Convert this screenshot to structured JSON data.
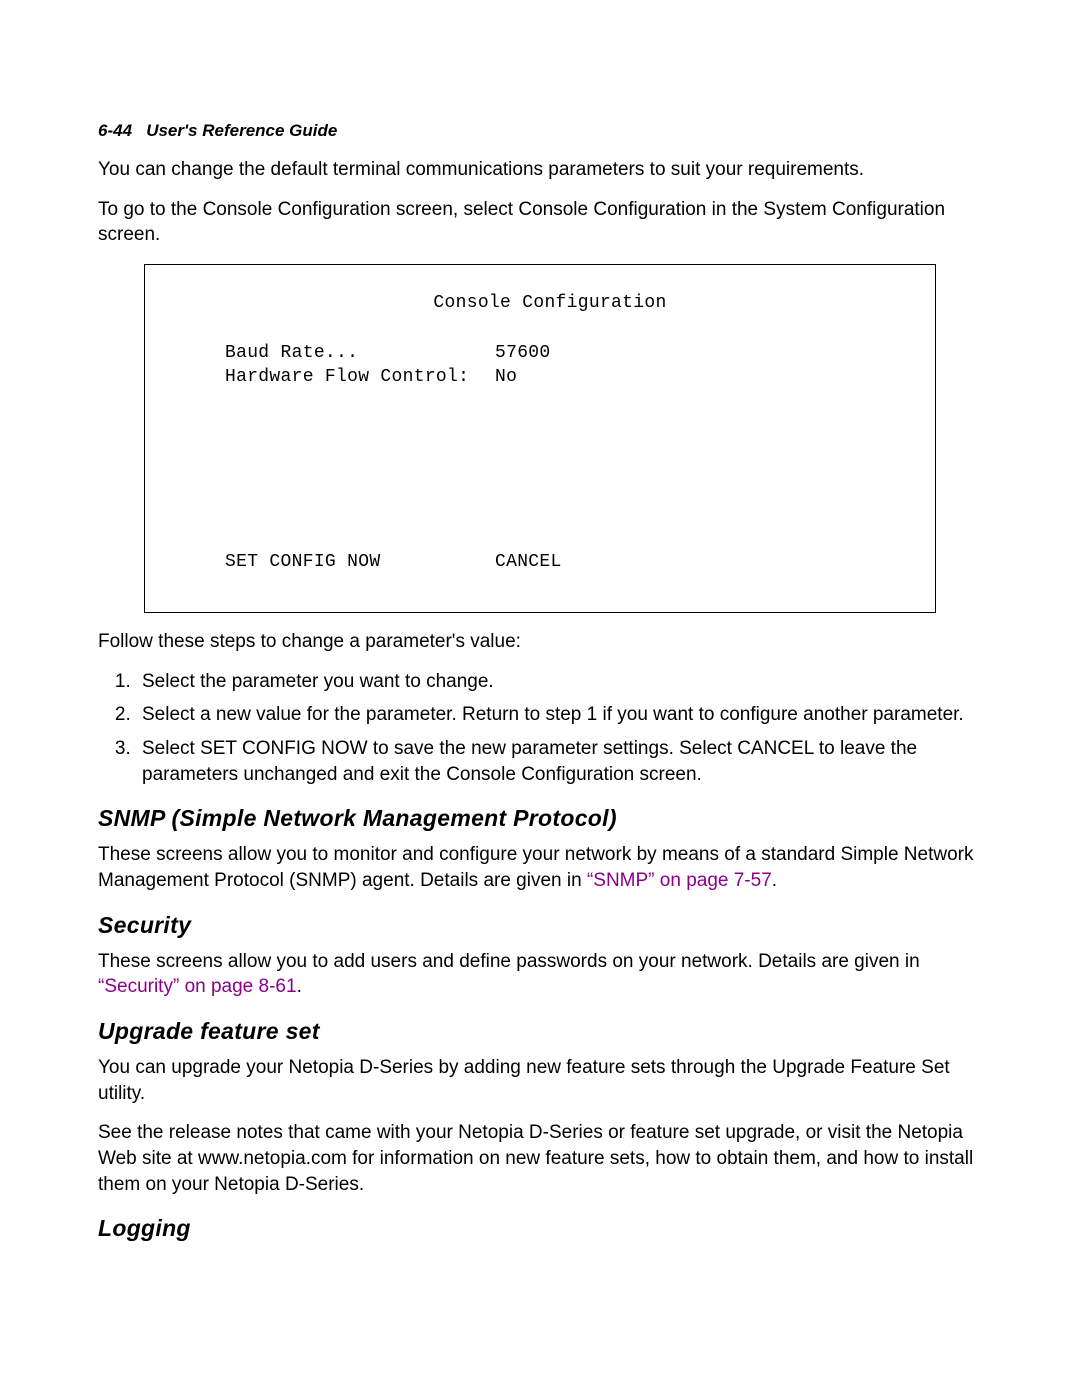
{
  "header": {
    "page_number": "6-44",
    "book_title": "User's Reference Guide"
  },
  "intro": {
    "para1": "You can change the default terminal communications parameters to suit your requirements.",
    "para2": "To go to the Console Configuration screen, select Console Configuration in the System Configuration screen."
  },
  "console": {
    "title": "Console Configuration",
    "row1_label": "Baud Rate...",
    "row1_value": "57600",
    "row2_label": "Hardware Flow Control:",
    "row2_value": "No",
    "action_set": "SET CONFIG NOW",
    "action_cancel": "CANCEL"
  },
  "steps": {
    "lead": "Follow these steps to change a parameter's value:",
    "items": [
      "Select the parameter you want to change.",
      "Select a new value for the parameter. Return to step 1 if you want to configure another parameter.",
      "Select SET CONFIG NOW to save the new parameter settings. Select CANCEL to leave the parameters unchanged and exit the Console Configuration screen."
    ]
  },
  "snmp": {
    "heading": "SNMP (Simple Network Management Protocol)",
    "body_pre": "These screens allow you to monitor and configure your network by means of a standard Simple Network Management Protocol (SNMP) agent. Details are given in ",
    "xref": "“SNMP” on page 7-57",
    "body_post": "."
  },
  "security": {
    "heading": "Security",
    "body_pre": "These screens allow you to add users and define passwords on your network. Details are given in ",
    "xref": "“Security” on page 8-61",
    "body_post": "."
  },
  "upgrade": {
    "heading": "Upgrade feature set",
    "para1": "You can upgrade your Netopia D-Series by adding new feature sets through the Upgrade Feature Set utility.",
    "para2": "See the release notes that came with your Netopia D-Series or feature set upgrade, or visit the Netopia Web site at www.netopia.com for information on new feature sets, how to obtain them, and how to install them on your Netopia D-Series."
  },
  "logging": {
    "heading": "Logging"
  }
}
